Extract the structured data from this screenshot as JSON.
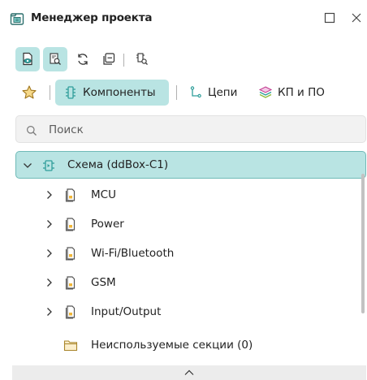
{
  "window": {
    "title": "Менеджер проекта",
    "title_icon": "project-manager-icon",
    "maximize_icon": "maximize-icon",
    "close_icon": "close-icon"
  },
  "toolbar": {
    "buttons": [
      {
        "icon": "document-view-icon",
        "active": true
      },
      {
        "icon": "document-search-icon",
        "active": true
      },
      {
        "icon": "refresh-icon",
        "active": false
      },
      {
        "icon": "collapse-all-icon",
        "active": false
      },
      {
        "icon": "find-component-icon",
        "active": false
      }
    ]
  },
  "tabs": {
    "favorites_icon": "star-icon",
    "items": [
      {
        "label": "Компоненты",
        "icon": "component-icon",
        "active": true
      },
      {
        "label": "Цепи",
        "icon": "net-icon",
        "active": false
      },
      {
        "label": "КП и ПО",
        "icon": "layers-icon",
        "active": false
      }
    ]
  },
  "search": {
    "placeholder": "Поиск",
    "value": ""
  },
  "tree": {
    "root": {
      "label": "Схема (ddBox-C1)",
      "icon": "schematic-icon",
      "expanded": true
    },
    "children": [
      {
        "label": "MCU",
        "icon": "sheet-icon"
      },
      {
        "label": "Power",
        "icon": "sheet-icon"
      },
      {
        "label": "Wi-Fi/Bluetooth",
        "icon": "sheet-icon"
      },
      {
        "label": "GSM",
        "icon": "sheet-icon"
      },
      {
        "label": "Input/Output",
        "icon": "sheet-icon"
      }
    ],
    "unused": {
      "label": "Неиспользуемые секции (0)",
      "icon": "folder-icon"
    }
  },
  "colors": {
    "accent_bg": "#b9e4e3",
    "accent_border": "#6fbab7",
    "icon_stroke": "#3a3a3a",
    "star": "#e8b23a",
    "tab_icon_teal": "#2f9e9a"
  }
}
